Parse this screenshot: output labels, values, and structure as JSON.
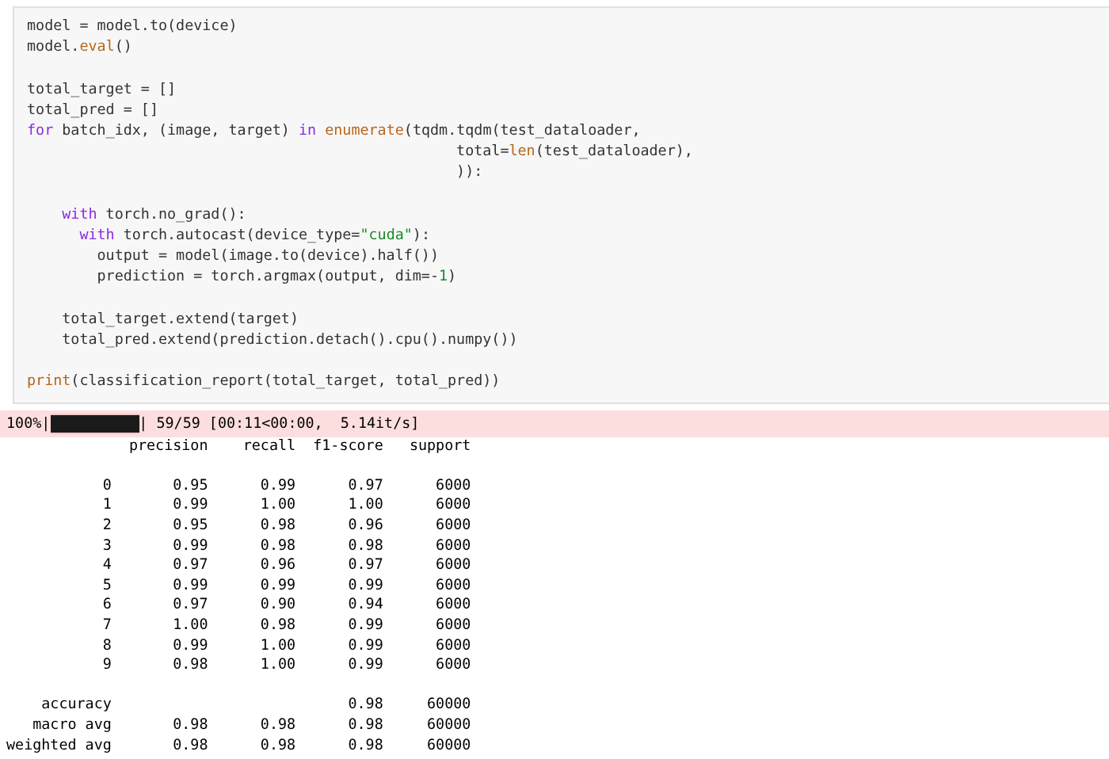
{
  "code_cell": {
    "lines": [
      {
        "tokens": [
          {
            "kind": "plain",
            "t": "model = model.to(device)"
          }
        ]
      },
      {
        "tokens": [
          {
            "kind": "plain",
            "t": "model."
          },
          {
            "kind": "builtin",
            "t": "eval"
          },
          {
            "kind": "plain",
            "t": "()"
          }
        ]
      },
      {
        "blank_before": true,
        "tokens": [
          {
            "kind": "plain",
            "t": "total_target = []"
          }
        ]
      },
      {
        "tokens": [
          {
            "kind": "plain",
            "t": "total_pred = []"
          }
        ]
      },
      {
        "tokens": [
          {
            "kind": "keyword",
            "t": "for"
          },
          {
            "kind": "plain",
            "t": " batch_idx, (image, target) "
          },
          {
            "kind": "keyword",
            "t": "in "
          },
          {
            "kind": "builtin",
            "t": "enumerate"
          },
          {
            "kind": "plain",
            "t": "(tqdm.tqdm(test_dataloader,"
          }
        ]
      },
      {
        "tokens": [
          {
            "kind": "plain",
            "t": "                                                 total="
          },
          {
            "kind": "builtin",
            "t": "len"
          },
          {
            "kind": "plain",
            "t": "(test_dataloader),"
          }
        ]
      },
      {
        "tokens": [
          {
            "kind": "plain",
            "t": "                                                 )):"
          }
        ]
      },
      {
        "blank_before": true,
        "tokens": [
          {
            "kind": "keyword",
            "t": "    with"
          },
          {
            "kind": "plain",
            "t": " torch.no_grad():"
          }
        ]
      },
      {
        "tokens": [
          {
            "kind": "keyword",
            "t": "      with"
          },
          {
            "kind": "plain",
            "t": " torch.autocast(device_type="
          },
          {
            "kind": "string",
            "t": "\"cuda\""
          },
          {
            "kind": "plain",
            "t": "):"
          }
        ]
      },
      {
        "tokens": [
          {
            "kind": "plain",
            "t": "        output = model(image.to(device).half())"
          }
        ]
      },
      {
        "tokens": [
          {
            "kind": "plain",
            "t": "        prediction = torch.argmax(output, dim=-"
          },
          {
            "kind": "number",
            "t": "1"
          },
          {
            "kind": "plain",
            "t": ")"
          }
        ]
      },
      {
        "blank_before": true,
        "tokens": [
          {
            "kind": "plain",
            "t": "    total_target.extend(target)"
          }
        ]
      },
      {
        "tokens": [
          {
            "kind": "plain",
            "t": "    total_pred.extend(prediction.detach().cpu().numpy())"
          }
        ]
      },
      {
        "blank_before": true,
        "tokens": [
          {
            "kind": "builtin",
            "t": "print"
          },
          {
            "kind": "plain",
            "t": "(classification_report(total_target, total_pred))"
          }
        ]
      }
    ]
  },
  "output": {
    "progress": {
      "percent": "100%|",
      "level": 1,
      "stats": "| 59/59 [00:11<00:00,  5.14it/s]"
    },
    "report_lines": [
      {
        "text": "              precision    recall  f1-score   support"
      },
      {
        "blank_before": true,
        "text": "           0       0.95      0.99      0.97      6000"
      },
      {
        "text": "           1       0.99      1.00      1.00      6000"
      },
      {
        "text": "           2       0.95      0.98      0.96      6000"
      },
      {
        "text": "           3       0.99      0.98      0.98      6000"
      },
      {
        "text": "           4       0.97      0.96      0.97      6000"
      },
      {
        "text": "           5       0.99      0.99      0.99      6000"
      },
      {
        "text": "           6       0.97      0.90      0.94      6000"
      },
      {
        "text": "           7       1.00      0.98      0.99      6000"
      },
      {
        "text": "           8       0.99      1.00      0.99      6000"
      },
      {
        "text": "           9       0.98      1.00      0.99      6000"
      },
      {
        "blank_before": true,
        "text": "    accuracy                           0.98     60000"
      },
      {
        "text": "   macro avg       0.98      0.98      0.98     60000"
      },
      {
        "text": "weighted avg       0.98      0.98      0.98     60000"
      }
    ]
  }
}
